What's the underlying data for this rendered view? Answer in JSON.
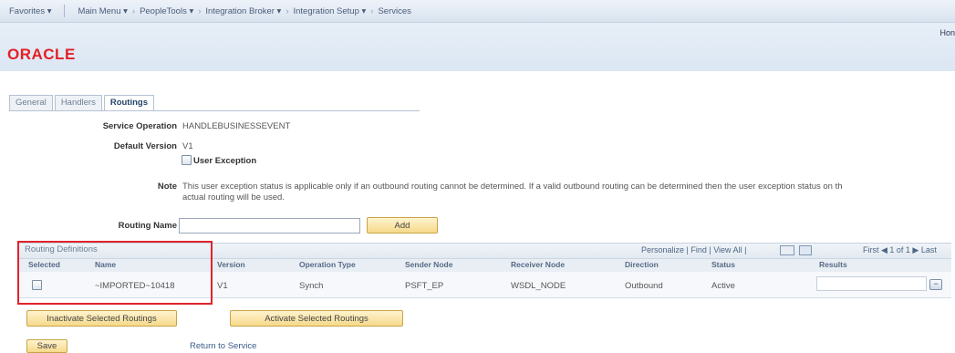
{
  "nav": {
    "items": [
      "Favorites ▾",
      "Main Menu ▾",
      "PeopleTools ▾",
      "Integration Broker ▾",
      "Integration Setup ▾",
      "Services"
    ]
  },
  "home_text": "Hon",
  "logo_text": "ORACLE",
  "tabs": [
    "General",
    "Handlers",
    "Routings"
  ],
  "form": {
    "service_operation_label": "Service Operation",
    "service_operation_value": "HANDLEBUSINESSEVENT",
    "default_version_label": "Default Version",
    "default_version_value": "V1",
    "user_exception_label": "User Exception",
    "note_label": "Note",
    "note_line1": "This user exception status is applicable only if an outbound routing cannot be determined.  If a valid outbound routing can be determined then the user exception status on th",
    "note_line2": "actual routing will be used.",
    "routing_name_label": "Routing Name",
    "routing_name_value": "",
    "add_button": "Add"
  },
  "grid": {
    "title": "Routing Definitions",
    "nav_text": "Personalize | Find | View All |",
    "pager_text": "First  ◀  1 of 1  ▶  Last",
    "columns": [
      "Selected",
      "Name",
      "Version",
      "Operation Type",
      "Sender Node",
      "Receiver Node",
      "Direction",
      "Status",
      "Results"
    ],
    "rows": [
      {
        "name": "~IMPORTED~10418",
        "version": "V1",
        "operation_type": "Synch",
        "sender_node": "PSFT_EP",
        "receiver_node": "WSDL_NODE",
        "direction": "Outbound",
        "status": "Active",
        "results": ""
      }
    ]
  },
  "buttons": {
    "inactivate": "Inactivate Selected Routings",
    "activate": "Activate Selected Routings",
    "save": "Save"
  },
  "links": {
    "return_to_service": "Return to Service"
  },
  "colors": {
    "logo": "#e41f26",
    "highlight_border": "#e1232b",
    "button_fill": "#f6d98a"
  }
}
